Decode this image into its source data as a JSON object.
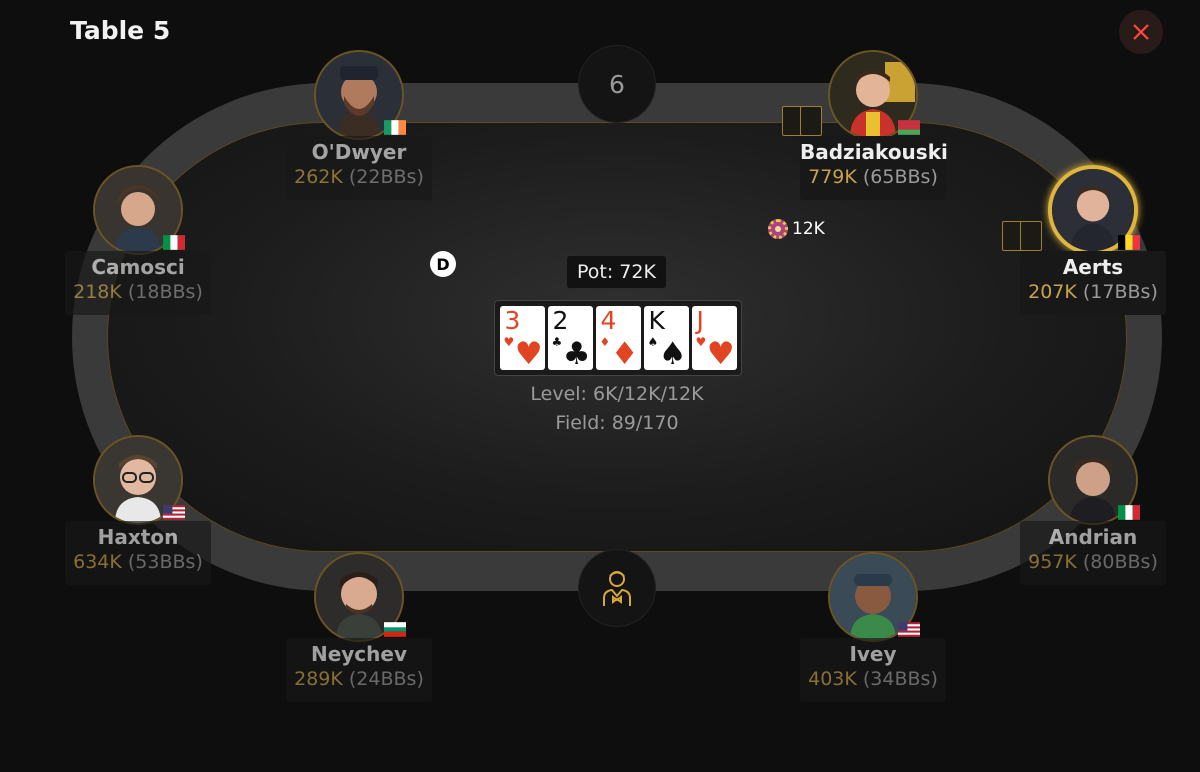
{
  "window": {
    "title": "Table 5",
    "close_icon": "close-icon",
    "accent": "#d8a73c",
    "close_color": "#ff4a3c"
  },
  "table": {
    "seat_number": "6",
    "pot_label": "Pot: 72K",
    "level_label": "Level: 6K/12K/12K",
    "field_label": "Field: 89/170",
    "dealer_button_label": "D",
    "dealer_icon": "dealer-icon"
  },
  "board": [
    {
      "rank": "3",
      "suit": "♥",
      "color": "red"
    },
    {
      "rank": "2",
      "suit": "♣",
      "color": "blk"
    },
    {
      "rank": "4",
      "suit": "♦",
      "color": "red"
    },
    {
      "rank": "K",
      "suit": "♠",
      "color": "blk"
    },
    {
      "rank": "J",
      "suit": "♥",
      "color": "red"
    }
  ],
  "bet": {
    "amount": "12K"
  },
  "players": [
    {
      "name": "O'Dwyer",
      "stack": "262K",
      "bbs": "(22BBs)",
      "flag": "ireland"
    },
    {
      "name": "Badziakouski",
      "stack": "779K",
      "bbs": "(65BBs)",
      "flag": "belarus"
    },
    {
      "name": "Camosci",
      "stack": "218K",
      "bbs": "(18BBs)",
      "flag": "italy"
    },
    {
      "name": "Aerts",
      "stack": "207K",
      "bbs": "(17BBs)",
      "flag": "belgium"
    },
    {
      "name": "Haxton",
      "stack": "634K",
      "bbs": "(53BBs)",
      "flag": "usa"
    },
    {
      "name": "Andrian",
      "stack": "957K",
      "bbs": "(80BBs)",
      "flag": "italy"
    },
    {
      "name": "Neychev",
      "stack": "289K",
      "bbs": "(24BBs)",
      "flag": "bulgaria"
    },
    {
      "name": "Ivey",
      "stack": "403K",
      "bbs": "(34BBs)",
      "flag": "usa"
    }
  ]
}
